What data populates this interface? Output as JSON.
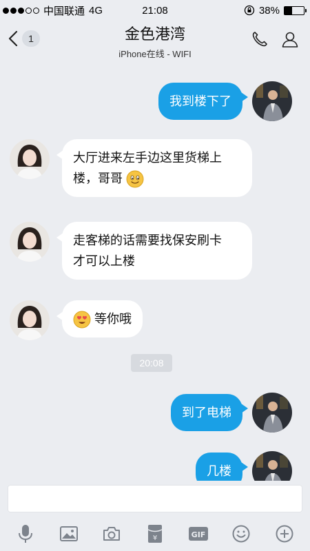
{
  "status_bar": {
    "carrier": "中国联通",
    "network": "4G",
    "time": "21:08",
    "battery": "38%",
    "battery_level": 0.38
  },
  "header": {
    "back_count": "1",
    "title": "金色港湾",
    "subtitle": "iPhone在线 - WIFI"
  },
  "messages": [
    {
      "side": "out",
      "text": "我到楼下了"
    },
    {
      "side": "in",
      "text": "大厅进来左手边这里货梯上",
      "text2": "楼，哥哥",
      "emoji": "smile"
    },
    {
      "side": "in",
      "text": "走客梯的话需要找保安刷卡",
      "text2": "才可以上楼"
    },
    {
      "side": "in",
      "emoji": "heart-eyes",
      "text": "等你哦"
    },
    {
      "type": "time",
      "text": "20:08"
    },
    {
      "side": "out",
      "text": "到了电梯"
    },
    {
      "side": "out",
      "text": "几楼"
    }
  ],
  "toolbar": {
    "items": [
      "mic-icon",
      "image-icon",
      "camera-icon",
      "red-packet-icon",
      "gif-icon",
      "emoji-icon",
      "plus-icon"
    ],
    "gif_label": "GIF"
  },
  "colors": {
    "outgoing_bubble": "#1aa0e6",
    "incoming_bubble": "#ffffff",
    "background": "#ebedf1"
  }
}
